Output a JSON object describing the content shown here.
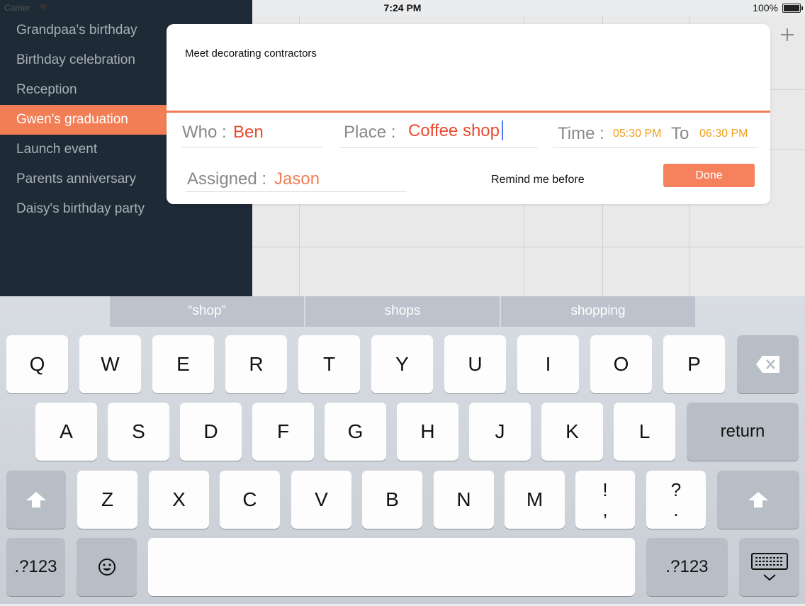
{
  "status_bar": {
    "carrier": "Carrier",
    "time": "7:24 PM",
    "battery_pct": "100%"
  },
  "sidebar": {
    "items": [
      {
        "label": "Grandpaa's birthday",
        "active": false
      },
      {
        "label": "Birthday celebration",
        "active": false
      },
      {
        "label": "Reception",
        "active": false
      },
      {
        "label": "Gwen's graduation",
        "active": true
      },
      {
        "label": "Launch event",
        "active": false
      },
      {
        "label": "Parents anniversary",
        "active": false
      },
      {
        "label": "Daisy's birthday party",
        "active": false
      }
    ]
  },
  "popup": {
    "title": "Meet decorating contractors",
    "who_label": "Who :",
    "who_value": "Ben",
    "place_label": "Place :",
    "place_value": "Coffee shop",
    "time_label": "Time :",
    "time_from": "05:30 PM",
    "to_label": "To",
    "time_to": "06:30 PM",
    "assigned_label": "Assigned :",
    "assigned_value": "Jason",
    "remind_label": "Remind me before",
    "done_label": "Done"
  },
  "keyboard": {
    "suggestions": [
      "“shop”",
      "shops",
      "shopping"
    ],
    "row1": [
      "Q",
      "W",
      "E",
      "R",
      "T",
      "Y",
      "U",
      "I",
      "O",
      "P"
    ],
    "row2": [
      "A",
      "S",
      "D",
      "F",
      "G",
      "H",
      "J",
      "K",
      "L"
    ],
    "row2_return": "return",
    "row3": [
      "Z",
      "X",
      "C",
      "V",
      "B",
      "N",
      "M"
    ],
    "row3_punct1": [
      "!",
      ","
    ],
    "row3_punct2": [
      "?",
      "."
    ],
    "numbers_label": ".?123"
  },
  "colors": {
    "accent": "#f27e56",
    "sidebar_bg": "#1e2a36",
    "value_red": "#e84a30",
    "time_orange": "#f0a020"
  }
}
